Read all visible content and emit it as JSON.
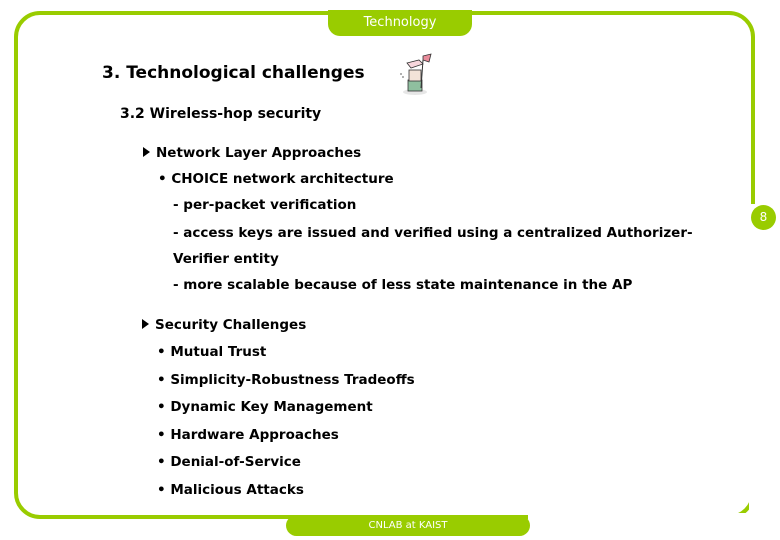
{
  "header": {
    "section_tab": "Technology"
  },
  "footer": {
    "label": "CNLAB at KAIST"
  },
  "page_number": "8",
  "slide": {
    "title": "3. Technological challenges",
    "subtitle": "3.2 Wireless-hop security",
    "sections": [
      {
        "heading": "Network Layer Approaches",
        "items": [
          "• CHOICE network architecture",
          "- per-packet verification",
          "- access keys are issued and verified using a centralized Authorizer-",
          "Verifier entity",
          "- more scalable because of less state maintenance in the AP"
        ]
      },
      {
        "heading": "Security Challenges",
        "items": [
          "• Mutual Trust",
          "• Simplicity-Robustness Tradeoffs",
          "• Dynamic Key Management",
          "• Hardware Approaches",
          "• Denial-of-Service",
          "• Malicious Attacks"
        ]
      }
    ]
  },
  "colors": {
    "accent": "#99cc00",
    "text": "#000000",
    "background": "#ffffff"
  }
}
